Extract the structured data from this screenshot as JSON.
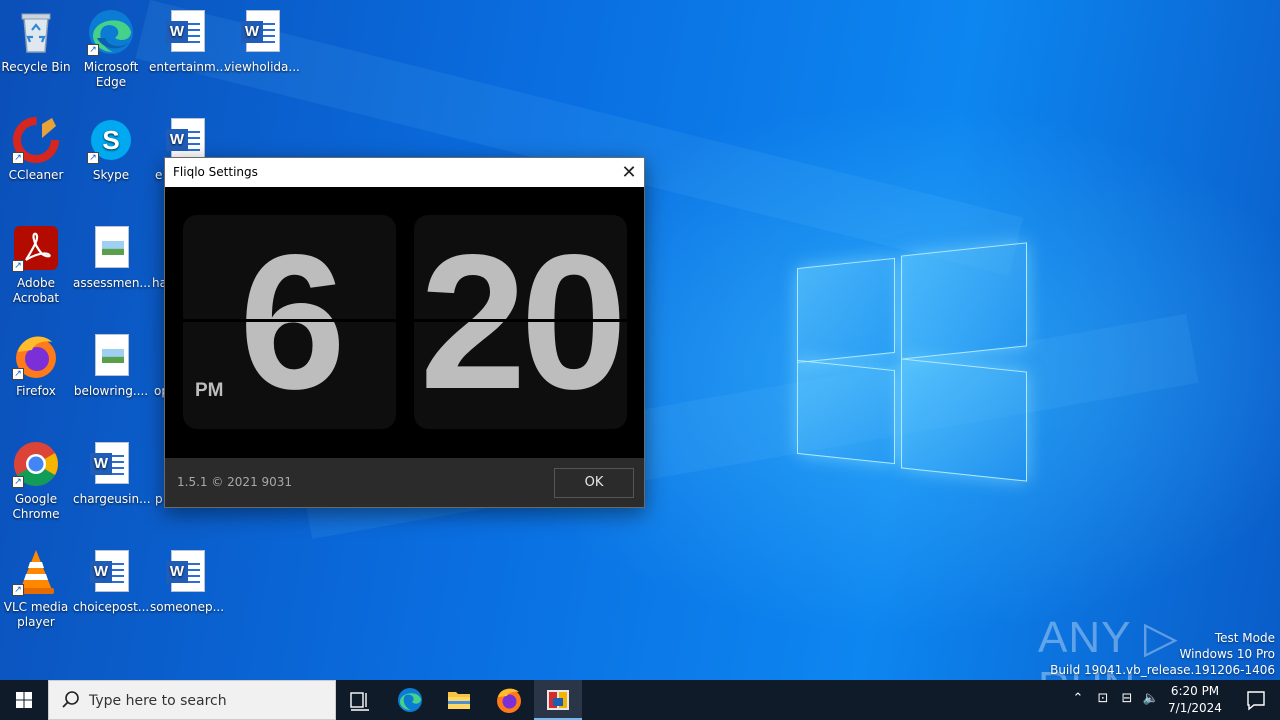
{
  "desktop": {
    "icons": [
      {
        "label": "Recycle Bin",
        "icon": "recycle-bin-icon"
      },
      {
        "label": "Microsoft Edge",
        "icon": "edge-icon"
      },
      {
        "label": "entertainm...",
        "icon": "word-doc-icon"
      },
      {
        "label": "viewholida...",
        "icon": "word-doc-icon"
      },
      {
        "label": "CCleaner",
        "icon": "ccleaner-icon"
      },
      {
        "label": "Skype",
        "icon": "skype-icon"
      },
      {
        "label": "e",
        "icon": "word-doc-icon"
      },
      {
        "label": "Adobe Acrobat",
        "icon": "acrobat-icon"
      },
      {
        "label": "assessmen...",
        "icon": "image-file-icon"
      },
      {
        "label": "ha",
        "icon": "file-icon"
      },
      {
        "label": "Firefox",
        "icon": "firefox-icon"
      },
      {
        "label": "belowring....",
        "icon": "image-file-icon"
      },
      {
        "label": "op",
        "icon": "file-icon"
      },
      {
        "label": "Google Chrome",
        "icon": "chrome-icon"
      },
      {
        "label": "chargeusin...",
        "icon": "word-doc-icon"
      },
      {
        "label": "p",
        "icon": "file-icon"
      },
      {
        "label": "VLC media player",
        "icon": "vlc-icon"
      },
      {
        "label": "choicepost...",
        "icon": "word-doc-icon"
      },
      {
        "label": "someonep...",
        "icon": "word-doc-icon"
      }
    ]
  },
  "dialog": {
    "title": "Fliqlo Settings",
    "close_symbol": "✕",
    "hours": "6",
    "minutes": "20",
    "ampm": "PM",
    "version": "1.5.1 © 2021 9031",
    "ok_label": "OK"
  },
  "watermark": {
    "brand": "ANY ▷ RUN",
    "line1": "Test Mode",
    "line2": "Windows 10 Pro",
    "line3": "Build 19041.vb_release.191206-1406"
  },
  "taskbar": {
    "search_placeholder": "Type here to search",
    "pinned": [
      "task-view-icon",
      "edge-icon",
      "file-explorer-icon",
      "firefox-icon",
      "fliqlo-icon"
    ],
    "time": "6:20 PM",
    "date": "7/1/2024"
  },
  "colors": {
    "taskbar": "#101b2a",
    "accent": "#76b9ed",
    "digit": "#bdbdbd"
  }
}
